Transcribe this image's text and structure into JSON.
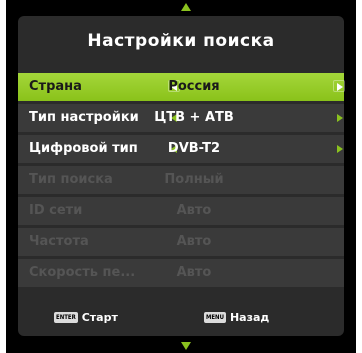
{
  "menu": {
    "title": "Настройки поиска",
    "rows": [
      {
        "label": "Страна",
        "value": "Россия"
      },
      {
        "label": "Тип настройки",
        "value": "ЦТВ + АТВ"
      },
      {
        "label": "Цифровой тип",
        "value": "DVB-T2"
      },
      {
        "label": "Тип поиска",
        "value": "Полный"
      },
      {
        "label": "ID сети",
        "value": "Авто"
      },
      {
        "label": "Частота",
        "value": "Авто"
      },
      {
        "label": "Скорость пе...",
        "value": "Авто"
      }
    ]
  },
  "footer": {
    "enter_key": "ENTER",
    "enter_label": "Старт",
    "menu_key": "MENU",
    "menu_label": "Назад"
  },
  "colors": {
    "accent": "#8bc21f",
    "panel": "#2b2b2b",
    "row": "#3a3a3a",
    "disabled_text": "#555555"
  }
}
